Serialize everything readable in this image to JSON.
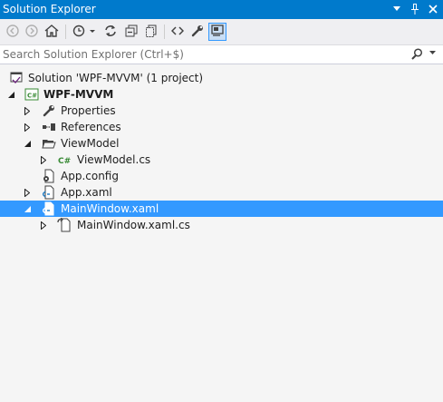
{
  "window": {
    "title": "Solution Explorer",
    "title_buttons": [
      "dropdown-arrow-icon",
      "pin-icon",
      "close-icon"
    ]
  },
  "toolbar": {
    "buttons": [
      {
        "name": "back-button",
        "icon": "back-arrow-icon",
        "enabled": false
      },
      {
        "name": "forward-button",
        "icon": "forward-arrow-icon",
        "enabled": false
      },
      {
        "name": "home-button",
        "icon": "home-icon",
        "enabled": true
      },
      {
        "name": "pending-changes-filter-button",
        "icon": "clock-filter-icon",
        "enabled": true
      },
      {
        "name": "sync-with-active-document-button",
        "icon": "sync-icon",
        "enabled": true
      },
      {
        "name": "collapse-all-button",
        "icon": "collapse-all-icon",
        "enabled": true
      },
      {
        "name": "show-all-files-button",
        "icon": "show-all-files-icon",
        "enabled": true
      },
      {
        "name": "view-code-button",
        "icon": "code-brackets-icon",
        "enabled": true
      },
      {
        "name": "properties-button",
        "icon": "wrench-icon",
        "enabled": true
      },
      {
        "name": "preview-selected-items-button",
        "icon": "preview-icon",
        "enabled": true,
        "active": true
      }
    ]
  },
  "search": {
    "placeholder": "Search Solution Explorer (Ctrl+$)"
  },
  "tree": {
    "items": [
      {
        "label": "Solution 'WPF-MVVM' (1 project)",
        "icon": "solution-icon",
        "expander": "none",
        "level": 0
      },
      {
        "label": "WPF-MVVM",
        "icon": "csharp-project-icon",
        "expander": "expanded",
        "level": 0,
        "bold": true
      },
      {
        "label": "Properties",
        "icon": "wrench-icon",
        "expander": "collapsed",
        "level": 1
      },
      {
        "label": "References",
        "icon": "references-icon",
        "expander": "collapsed",
        "level": 1
      },
      {
        "label": "ViewModel",
        "icon": "folder-open-icon",
        "expander": "expanded",
        "level": 1
      },
      {
        "label": "ViewModel.cs",
        "icon": "csharp-file-icon",
        "expander": "collapsed",
        "level": 2
      },
      {
        "label": "App.config",
        "icon": "config-file-icon",
        "expander": "none",
        "level": 1
      },
      {
        "label": "App.xaml",
        "icon": "xaml-file-icon",
        "expander": "collapsed",
        "level": 1
      },
      {
        "label": "MainWindow.xaml",
        "icon": "xaml-file-icon",
        "expander": "expanded",
        "level": 1,
        "selected": true
      },
      {
        "label": "MainWindow.xaml.cs",
        "icon": "code-behind-file-icon",
        "expander": "collapsed",
        "level": 2
      }
    ]
  },
  "colors": {
    "accent": "#007acc",
    "selection": "#3399ff",
    "background": "#f5f5f5",
    "toolbar": "#efeff2"
  }
}
